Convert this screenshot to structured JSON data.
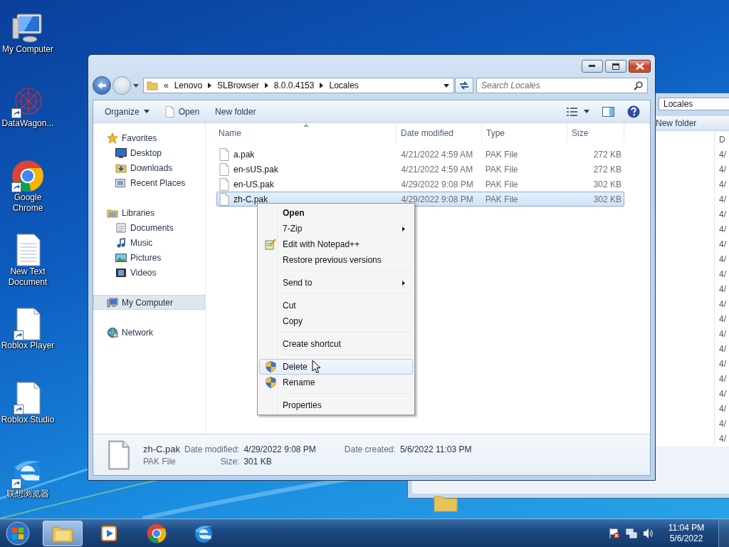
{
  "desktop_icons": [
    {
      "label": "My Computer",
      "kind": "computer",
      "shortcut": false
    },
    {
      "label": "DataWagon...",
      "kind": "network",
      "shortcut": true
    },
    {
      "label": "Google Chrome",
      "kind": "chrome",
      "shortcut": true
    },
    {
      "label": "New Text Document",
      "kind": "text",
      "shortcut": false
    },
    {
      "label": "Roblox Player",
      "kind": "blank",
      "shortcut": true
    },
    {
      "label": "Roblox Studio",
      "kind": "blank",
      "shortcut": true
    },
    {
      "label": "联想浏览器",
      "kind": "browser",
      "shortcut": true
    }
  ],
  "back_window": {
    "address": "Locales",
    "toolbar": "New folder",
    "column": "D",
    "rows": [
      "4/",
      "4/",
      "4/",
      "4/",
      "4/",
      "4/",
      "4/",
      "4/",
      "4/",
      "4/",
      "4/",
      "4/",
      "4/",
      "4/",
      "4/",
      "4/",
      "4/",
      "4/",
      "4/",
      "4/"
    ]
  },
  "window": {
    "address": {
      "overflow": "«",
      "breadcrumb": [
        "Lenovo",
        "SLBrowser",
        "8.0.0.4153",
        "Locales"
      ]
    },
    "search": {
      "placeholder": "Search Locales"
    },
    "toolbar": [
      {
        "label": "Organize",
        "kind": "menu"
      },
      {
        "label": "Open",
        "kind": "open"
      },
      {
        "label": "New folder",
        "kind": "plain"
      }
    ],
    "sidebar": [
      {
        "label": "Favorites",
        "kind": "star",
        "selected": false,
        "children": [
          {
            "label": "Desktop",
            "kind": "desktop",
            "selected": false
          },
          {
            "label": "Downloads",
            "kind": "downloads",
            "selected": false
          },
          {
            "label": "Recent Places",
            "kind": "recent",
            "selected": false
          }
        ]
      },
      {
        "label": "Libraries",
        "kind": "libraries",
        "selected": false,
        "children": [
          {
            "label": "Documents",
            "kind": "documents",
            "selected": false
          },
          {
            "label": "Music",
            "kind": "music",
            "selected": false
          },
          {
            "label": "Pictures",
            "kind": "pictures",
            "selected": false
          },
          {
            "label": "Videos",
            "kind": "videos",
            "selected": false
          }
        ]
      },
      {
        "label": "My Computer",
        "kind": "computer",
        "selected": true
      },
      {
        "label": "Network",
        "kind": "network",
        "selected": false
      }
    ],
    "table": {
      "columns": [
        "Name",
        "Date modified",
        "Type",
        "Size"
      ],
      "rows": [
        {
          "name": "a.pak",
          "date": "4/21/2022 4:59 AM",
          "type": "PAK File",
          "size": "272 KB",
          "selected": false
        },
        {
          "name": "en-sUS.pak",
          "date": "4/21/2022 4:59 AM",
          "type": "PAK File",
          "size": "272 KB",
          "selected": false
        },
        {
          "name": "en-US.pak",
          "date": "4/29/2022 9:08 PM",
          "type": "PAK File",
          "size": "302 KB",
          "selected": false
        },
        {
          "name": "zh-C.pak",
          "date": "4/29/2022 9:08 PM",
          "type": "PAK File",
          "size": "302 KB",
          "selected": true
        }
      ]
    },
    "details": {
      "name": "zh-C.pak",
      "type": "PAK File",
      "modified_label": "Date modified:",
      "modified": "4/29/2022 9:08 PM",
      "size_label": "Size:",
      "size": "301 KB",
      "created_label": "Date created:",
      "created": "5/6/2022 11:03 PM"
    }
  },
  "context_menu": {
    "groups": [
      [
        {
          "label": "Open",
          "default": true,
          "submenu": false,
          "kind": "plain",
          "selected": false
        },
        {
          "label": "7-Zip",
          "default": false,
          "submenu": true,
          "kind": "plain",
          "selected": false
        },
        {
          "label": "Edit with Notepad++",
          "default": false,
          "submenu": false,
          "kind": "notepad",
          "selected": false
        },
        {
          "label": "Restore previous versions",
          "default": false,
          "submenu": false,
          "kind": "plain",
          "selected": false
        }
      ],
      [
        {
          "label": "Send to",
          "default": false,
          "submenu": true,
          "kind": "plain",
          "selected": false
        }
      ],
      [
        {
          "label": "Cut",
          "default": false,
          "submenu": false,
          "kind": "plain",
          "selected": false
        },
        {
          "label": "Copy",
          "default": false,
          "submenu": false,
          "kind": "plain",
          "selected": false
        }
      ],
      [
        {
          "label": "Create shortcut",
          "default": false,
          "submenu": false,
          "kind": "plain",
          "selected": false
        }
      ],
      [
        {
          "label": "Delete",
          "default": false,
          "submenu": false,
          "kind": "elevated",
          "selected": true
        },
        {
          "label": "Rename",
          "default": false,
          "submenu": false,
          "kind": "elevated",
          "selected": false
        }
      ],
      [
        {
          "label": "Properties",
          "default": false,
          "submenu": false,
          "kind": "plain",
          "selected": false
        }
      ]
    ]
  },
  "taskbar": {
    "apps": [
      {
        "kind": "explorer",
        "active": true
      },
      {
        "kind": "media",
        "active": false
      },
      {
        "kind": "chrome",
        "active": false
      },
      {
        "kind": "browser",
        "active": false
      }
    ],
    "time": "11:04 PM",
    "date": "5/6/2022"
  }
}
